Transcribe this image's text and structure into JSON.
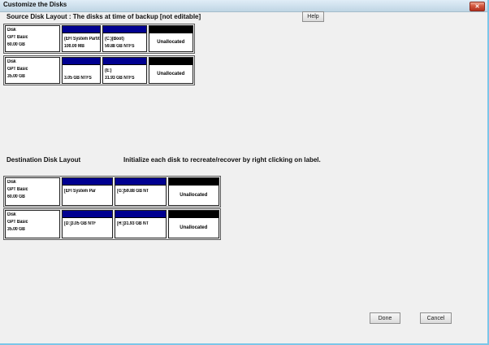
{
  "window": {
    "title": "Customize the Disks"
  },
  "icons": {
    "close": "✕"
  },
  "colors": {
    "partition_bar": "#000090",
    "unallocated_bar": "#000000",
    "window_border": "#7cc6e8",
    "title_bar": "#c9dcea"
  },
  "source": {
    "heading": "Source Disk Layout : The disks at time of backup [not editable]",
    "help_label": "Help",
    "disks": [
      {
        "label_lines": [
          "Disk",
          "GPT Basic",
          "60.00 GB"
        ],
        "partitions": [
          {
            "type": "partition",
            "lines": [
              "(EFI System Partiti",
              "100.00 MB"
            ]
          },
          {
            "type": "partition",
            "lines": [
              "(C:)(Boot)",
              "59.88 GB NTFS"
            ]
          },
          {
            "type": "unallocated",
            "lines": [
              "Unallocated"
            ]
          }
        ]
      },
      {
        "label_lines": [
          "Disk",
          "GPT Basic",
          "35.00 GB"
        ],
        "partitions": [
          {
            "type": "partition",
            "lines": [
              "3.05 GB NTFS"
            ]
          },
          {
            "type": "partition",
            "lines": [
              "(E:)",
              "31.93 GB NTFS"
            ]
          },
          {
            "type": "unallocated",
            "lines": [
              "Unallocated"
            ]
          }
        ]
      }
    ]
  },
  "destination": {
    "heading": "Destination Disk Layout",
    "instruction": "Initialize each disk to recreate/recover by right clicking on label.",
    "disks": [
      {
        "label_lines": [
          "Disk",
          "GPT Basic",
          "60.00 GB"
        ],
        "partitions": [
          {
            "type": "partition",
            "lines": [
              "[EFI System Par"
            ]
          },
          {
            "type": "partition",
            "lines": [
              "[G:]59.88 GB NT"
            ]
          },
          {
            "type": "unallocated",
            "lines": [
              "Unallocated"
            ]
          }
        ]
      },
      {
        "label_lines": [
          "Disk",
          "GPT Basic",
          "35.00 GB"
        ],
        "partitions": [
          {
            "type": "partition",
            "lines": [
              "[D:]3.05 GB NTF"
            ]
          },
          {
            "type": "partition",
            "lines": [
              "[H:]31.93 GB NT"
            ]
          },
          {
            "type": "unallocated",
            "lines": [
              "Unallocated"
            ]
          }
        ]
      }
    ]
  },
  "footer": {
    "done_label": "Done",
    "cancel_label": "Cancel"
  }
}
